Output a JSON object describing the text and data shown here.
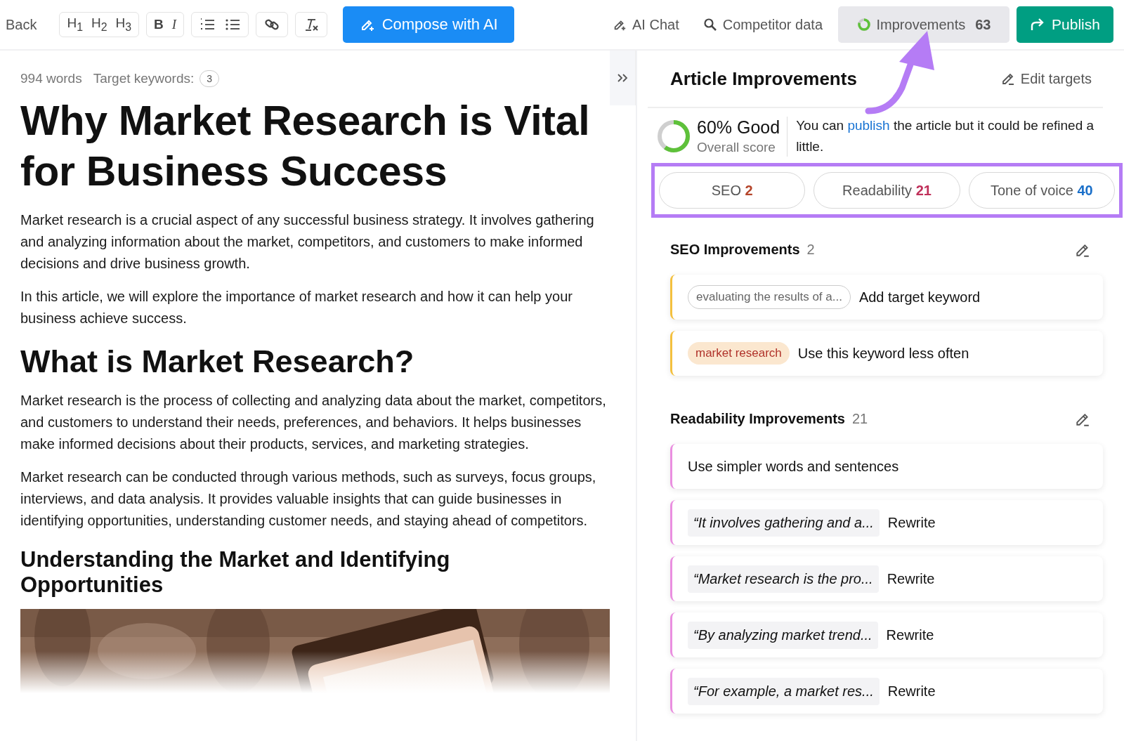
{
  "toolbar": {
    "back": "Back",
    "headings": [
      "H$_{1}$",
      "H$_{2}$",
      "H$_{3}$"
    ],
    "bold": "B",
    "italic": "I",
    "compose": "Compose with AI",
    "ai_chat": "AI Chat",
    "competitor": "Competitor data",
    "improvements": {
      "label": "Improvements",
      "count": "63",
      "level": 0.8
    },
    "publish": "Publish"
  },
  "editor": {
    "word_count": "994 words",
    "target_label": "Target keywords:",
    "target_count": "3",
    "blocks": [
      {
        "kind": "h1",
        "text": "Why Market Research is Vital for Business Success"
      },
      {
        "kind": "p",
        "text": "Market research is a crucial aspect of any successful business strategy. It involves gathering and analyzing information about the market, competitors, and customers to make informed decisions and drive business growth."
      },
      {
        "kind": "p",
        "text": "In this article, we will explore the importance of market research and how it can help your business achieve success."
      },
      {
        "kind": "h2",
        "text": "What is Market Research?"
      },
      {
        "kind": "p",
        "text": "Market research is the process of collecting and analyzing data about the market, competitors, and customers to understand their needs, preferences, and behaviors. It helps businesses make informed decisions about their products, services, and marketing strategies."
      },
      {
        "kind": "p",
        "text": "Market research can be conducted through various methods, such as surveys, focus groups, interviews, and data analysis. It provides valuable insights that can guide businesses in identifying opportunities, understanding customer needs, and staying ahead of competitors."
      },
      {
        "kind": "h3",
        "text": "Understanding the Market and Identifying Opportunities"
      },
      {
        "kind": "picture"
      }
    ]
  },
  "panel": {
    "title": "Article Improvements",
    "edit_targets": "Edit targets",
    "score": {
      "label": "60% Good",
      "caption": "Overall score",
      "level": 0.6
    },
    "message": {
      "before": "You can",
      "link": "publish",
      "after": "the article but it could be refined a little."
    },
    "tabs": [
      {
        "label": "SEO",
        "count": "2",
        "color": "#b5452a"
      },
      {
        "label": "Readability",
        "count": "21",
        "color": "#c0305a"
      },
      {
        "label": "Tone of voice",
        "count": "40",
        "color": "#1a6fc9"
      }
    ],
    "sections": [
      {
        "title": "SEO Improvements",
        "count": "2",
        "color": "#f4c03e",
        "items": [
          {
            "kind": "target",
            "tag": "evaluating the results of a...",
            "text": "Add target keyword"
          },
          {
            "kind": "overused",
            "tag": "market research",
            "text": "Use this keyword less often"
          }
        ]
      },
      {
        "title": "Readability Improvements",
        "count": "21",
        "color": "#ea8fe0",
        "items": [
          {
            "kind": "plain",
            "text": "Use simpler words and sentences"
          },
          {
            "kind": "rewrite",
            "tag": "“It involves gathering and a...",
            "text": "Rewrite"
          },
          {
            "kind": "rewrite",
            "tag": "“Market research is the pro...",
            "text": "Rewrite"
          },
          {
            "kind": "rewrite",
            "tag": "“By analyzing market trend...",
            "text": "Rewrite"
          },
          {
            "kind": "rewrite",
            "tag": "“For example, a market res...",
            "text": "Rewrite"
          }
        ]
      }
    ]
  }
}
